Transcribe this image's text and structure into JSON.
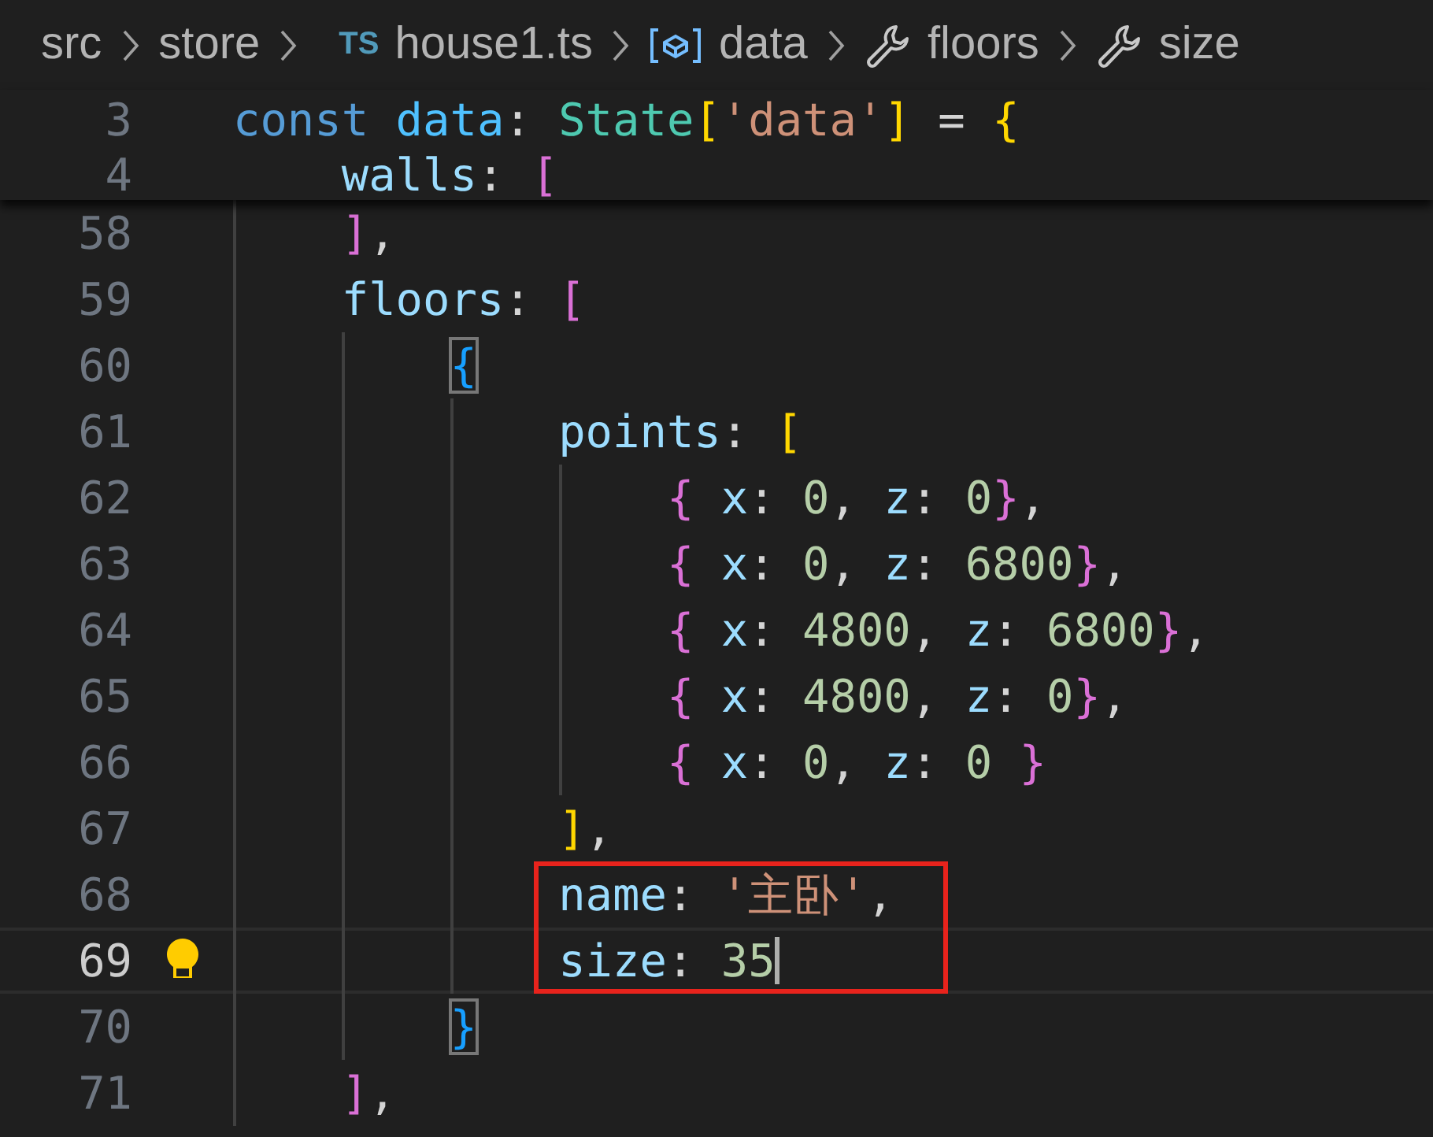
{
  "breadcrumb": [
    {
      "kind": "folder",
      "label": "src"
    },
    {
      "kind": "folder",
      "label": "store"
    },
    {
      "kind": "file",
      "badge": "TS",
      "label": "house1.ts"
    },
    {
      "kind": "variable",
      "label": "data"
    },
    {
      "kind": "property",
      "label": "floors"
    },
    {
      "kind": "property",
      "label": "size"
    }
  ],
  "sticky_lines": [
    {
      "number": "3",
      "tokens": [
        {
          "t": "const",
          "color": "#569cd6"
        },
        {
          "t": " data",
          "color": "#4fc1ff"
        },
        {
          "t": ": ",
          "color": "#d4d4d4"
        },
        {
          "t": "State",
          "color": "#4ec9b0"
        },
        {
          "t": "[",
          "color": "#ffd700"
        },
        {
          "t": "'data'",
          "color": "#ce9178"
        },
        {
          "t": "]",
          "color": "#ffd700"
        },
        {
          "t": " = ",
          "color": "#d4d4d4"
        },
        {
          "t": "{",
          "color": "#ffd700"
        }
      ]
    },
    {
      "number": "4",
      "tokens": [
        {
          "t": "    walls",
          "color": "#9cdcfe"
        },
        {
          "t": ": ",
          "color": "#d4d4d4"
        },
        {
          "t": "[",
          "color": "#da70d6"
        }
      ]
    }
  ],
  "lines": [
    {
      "number": "58",
      "current": false,
      "boxed": false,
      "tokens": [
        {
          "t": "    ]",
          "color": "#da70d6"
        },
        {
          "t": ",",
          "color": "#d4d4d4"
        }
      ]
    },
    {
      "number": "59",
      "current": false,
      "boxed": false,
      "tokens": [
        {
          "t": "    floors",
          "color": "#9cdcfe"
        },
        {
          "t": ": ",
          "color": "#d4d4d4"
        },
        {
          "t": "[",
          "color": "#da70d6"
        }
      ]
    },
    {
      "number": "60",
      "current": false,
      "boxed": false,
      "tokens": [
        {
          "t": "        {",
          "color": "#179fff",
          "match": true
        }
      ]
    },
    {
      "number": "61",
      "current": false,
      "boxed": false,
      "tokens": [
        {
          "t": "            points",
          "color": "#9cdcfe"
        },
        {
          "t": ": ",
          "color": "#d4d4d4"
        },
        {
          "t": "[",
          "color": "#ffd700"
        }
      ]
    },
    {
      "number": "62",
      "current": false,
      "boxed": false,
      "tokens": [
        {
          "t": "                {",
          "color": "#da70d6"
        },
        {
          "t": " x",
          "color": "#9cdcfe"
        },
        {
          "t": ": ",
          "color": "#d4d4d4"
        },
        {
          "t": "0",
          "color": "#b5cea8"
        },
        {
          "t": ", ",
          "color": "#d4d4d4"
        },
        {
          "t": "z",
          "color": "#9cdcfe"
        },
        {
          "t": ": ",
          "color": "#d4d4d4"
        },
        {
          "t": "0",
          "color": "#b5cea8"
        },
        {
          "t": "}",
          "color": "#da70d6"
        },
        {
          "t": ",",
          "color": "#d4d4d4"
        }
      ]
    },
    {
      "number": "63",
      "current": false,
      "boxed": false,
      "tokens": [
        {
          "t": "                {",
          "color": "#da70d6"
        },
        {
          "t": " x",
          "color": "#9cdcfe"
        },
        {
          "t": ": ",
          "color": "#d4d4d4"
        },
        {
          "t": "0",
          "color": "#b5cea8"
        },
        {
          "t": ", ",
          "color": "#d4d4d4"
        },
        {
          "t": "z",
          "color": "#9cdcfe"
        },
        {
          "t": ": ",
          "color": "#d4d4d4"
        },
        {
          "t": "6800",
          "color": "#b5cea8"
        },
        {
          "t": "}",
          "color": "#da70d6"
        },
        {
          "t": ",",
          "color": "#d4d4d4"
        }
      ]
    },
    {
      "number": "64",
      "current": false,
      "boxed": false,
      "tokens": [
        {
          "t": "                {",
          "color": "#da70d6"
        },
        {
          "t": " x",
          "color": "#9cdcfe"
        },
        {
          "t": ": ",
          "color": "#d4d4d4"
        },
        {
          "t": "4800",
          "color": "#b5cea8"
        },
        {
          "t": ", ",
          "color": "#d4d4d4"
        },
        {
          "t": "z",
          "color": "#9cdcfe"
        },
        {
          "t": ": ",
          "color": "#d4d4d4"
        },
        {
          "t": "6800",
          "color": "#b5cea8"
        },
        {
          "t": "}",
          "color": "#da70d6"
        },
        {
          "t": ",",
          "color": "#d4d4d4"
        }
      ]
    },
    {
      "number": "65",
      "current": false,
      "boxed": false,
      "tokens": [
        {
          "t": "                {",
          "color": "#da70d6"
        },
        {
          "t": " x",
          "color": "#9cdcfe"
        },
        {
          "t": ": ",
          "color": "#d4d4d4"
        },
        {
          "t": "4800",
          "color": "#b5cea8"
        },
        {
          "t": ", ",
          "color": "#d4d4d4"
        },
        {
          "t": "z",
          "color": "#9cdcfe"
        },
        {
          "t": ": ",
          "color": "#d4d4d4"
        },
        {
          "t": "0",
          "color": "#b5cea8"
        },
        {
          "t": "}",
          "color": "#da70d6"
        },
        {
          "t": ",",
          "color": "#d4d4d4"
        }
      ]
    },
    {
      "number": "66",
      "current": false,
      "boxed": false,
      "tokens": [
        {
          "t": "                {",
          "color": "#da70d6"
        },
        {
          "t": " x",
          "color": "#9cdcfe"
        },
        {
          "t": ": ",
          "color": "#d4d4d4"
        },
        {
          "t": "0",
          "color": "#b5cea8"
        },
        {
          "t": ", ",
          "color": "#d4d4d4"
        },
        {
          "t": "z",
          "color": "#9cdcfe"
        },
        {
          "t": ": ",
          "color": "#d4d4d4"
        },
        {
          "t": "0",
          "color": "#b5cea8"
        },
        {
          "t": " }",
          "color": "#da70d6"
        }
      ]
    },
    {
      "number": "67",
      "current": false,
      "boxed": false,
      "tokens": [
        {
          "t": "            ]",
          "color": "#ffd700"
        },
        {
          "t": ",",
          "color": "#d4d4d4"
        }
      ]
    },
    {
      "number": "68",
      "current": false,
      "boxed": true,
      "tokens": [
        {
          "t": "            name",
          "color": "#9cdcfe"
        },
        {
          "t": ": ",
          "color": "#d4d4d4"
        },
        {
          "t": "'主卧'",
          "color": "#ce9178"
        },
        {
          "t": ",",
          "color": "#d4d4d4"
        }
      ]
    },
    {
      "number": "69",
      "current": true,
      "boxed": true,
      "tokens": [
        {
          "t": "            size",
          "color": "#9cdcfe"
        },
        {
          "t": ": ",
          "color": "#d4d4d4"
        },
        {
          "t": "35",
          "color": "#b5cea8"
        }
      ]
    },
    {
      "number": "70",
      "current": false,
      "boxed": false,
      "tokens": [
        {
          "t": "        }",
          "color": "#179fff",
          "match": true
        }
      ]
    },
    {
      "number": "71",
      "current": false,
      "boxed": false,
      "tokens": [
        {
          "t": "    ]",
          "color": "#da70d6"
        },
        {
          "t": ",",
          "color": "#d4d4d4"
        }
      ]
    }
  ]
}
